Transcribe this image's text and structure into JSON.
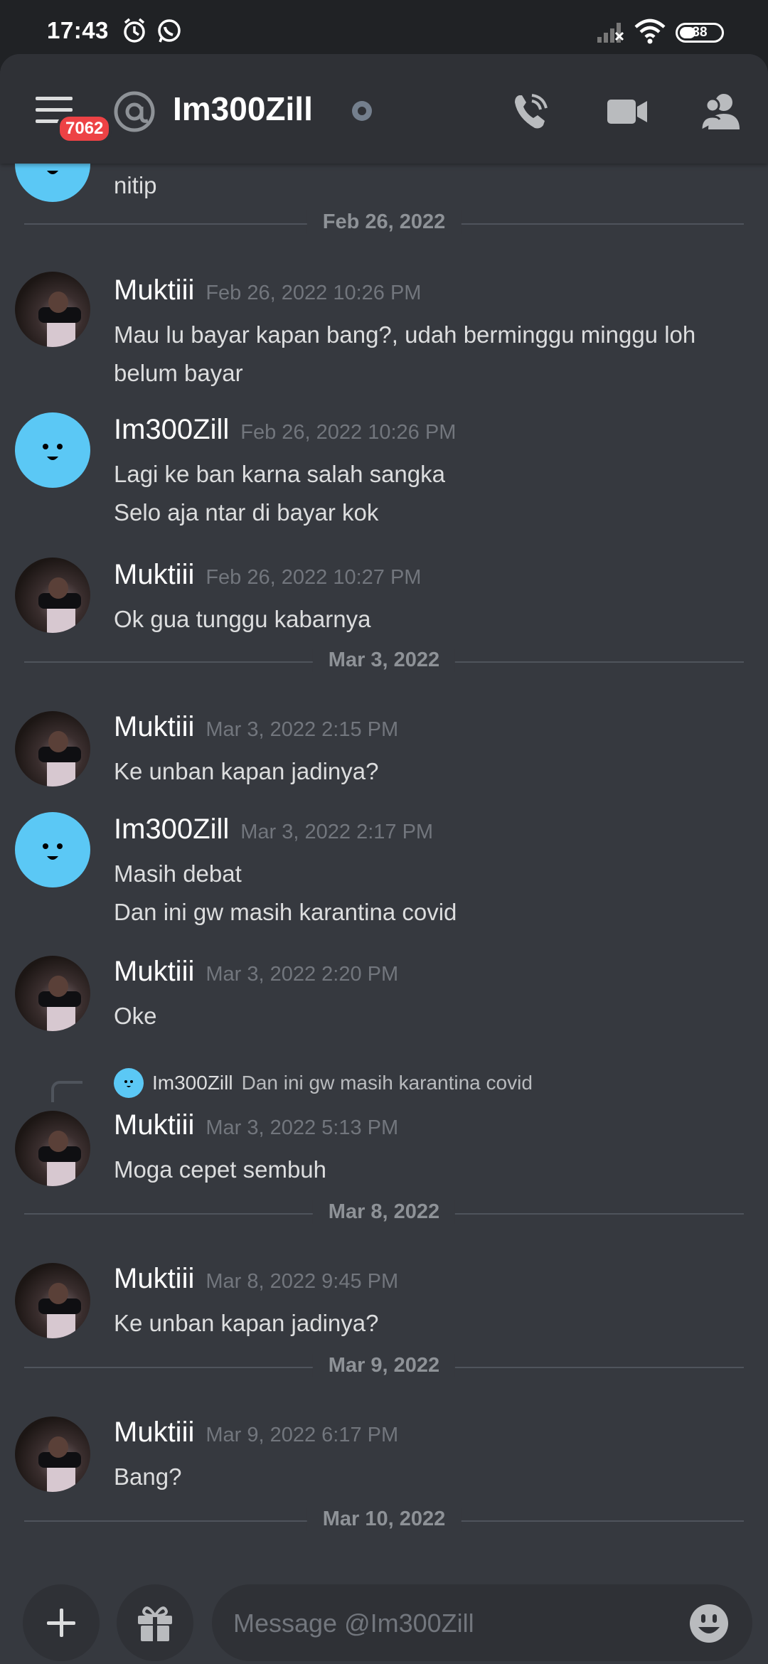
{
  "status_bar": {
    "time": "17:43",
    "battery": "38"
  },
  "header": {
    "unread_badge": "7062",
    "at_symbol": "@",
    "title": "Im300Zill",
    "status": "offline"
  },
  "messages": {
    "prev_text": "nitip",
    "dates": [
      "Feb 26, 2022",
      "Mar 3, 2022",
      "Mar 8, 2022",
      "Mar 9, 2022",
      "Mar 10, 2022"
    ],
    "items": [
      {
        "author": "Muktiii",
        "time": "Feb 26, 2022 10:26 PM",
        "lines": [
          "Mau lu bayar kapan bang?, udah berminggu minggu loh",
          "belum bayar"
        ]
      },
      {
        "author": "Im300Zill",
        "time": "Feb 26, 2022 10:26 PM",
        "lines": [
          "Lagi ke ban karna salah sangka",
          "Selo aja ntar di bayar kok"
        ]
      },
      {
        "author": "Muktiii",
        "time": "Feb 26, 2022 10:27 PM",
        "lines": [
          "Ok gua tunggu kabarnya"
        ]
      },
      {
        "author": "Muktiii",
        "time": "Mar 3, 2022 2:15 PM",
        "lines": [
          "Ke unban kapan jadinya?"
        ]
      },
      {
        "author": "Im300Zill",
        "time": "Mar 3, 2022 2:17 PM",
        "lines": [
          "Masih debat",
          "Dan ini gw masih karantina covid"
        ]
      },
      {
        "author": "Muktiii",
        "time": "Mar 3, 2022 2:20 PM",
        "lines": [
          "Oke"
        ]
      },
      {
        "author": "Muktiii",
        "time": "Mar 3, 2022 5:13 PM",
        "lines": [
          "Moga cepet sembuh"
        ],
        "reply_author": "Im300Zill",
        "reply_text": "Dan ini gw masih karantina covid"
      },
      {
        "author": "Muktiii",
        "time": "Mar 8, 2022 9:45 PM",
        "lines": [
          "Ke unban kapan jadinya?"
        ]
      },
      {
        "author": "Muktiii",
        "time": "Mar 9, 2022 6:17 PM",
        "lines": [
          "Bang?"
        ]
      }
    ]
  },
  "composer": {
    "placeholder": "Message @Im300Zill"
  },
  "colors": {
    "background": "#36393f",
    "header": "#2f3136",
    "accent_blue": "#5bc8f5",
    "badge_red": "#ed4245"
  }
}
